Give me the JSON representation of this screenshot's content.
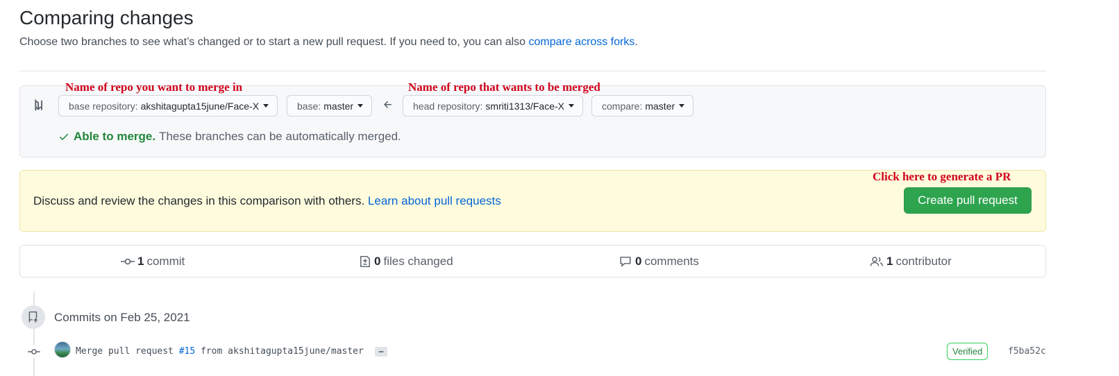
{
  "header": {
    "title": "Comparing changes",
    "subtitle_prefix": "Choose two branches to see what’s changed or to start a new pull request. If you need to, you can also ",
    "subtitle_link": "compare across forks",
    "subtitle_suffix": "."
  },
  "range": {
    "annotation_base": "Name of repo you want to merge in",
    "annotation_head": "Name of repo that wants to be merged",
    "base_repo_label": "base repository:",
    "base_repo_value": "akshitagupta15june/Face-X",
    "base_label": "base:",
    "base_value": "master",
    "head_repo_label": "head repository:",
    "head_repo_value": "smriti1313/Face-X",
    "compare_label": "compare:",
    "compare_value": "master",
    "status_strong": "Able to merge.",
    "status_text": "These branches can be automatically merged."
  },
  "prompt": {
    "annotation": "Click here to generate a PR",
    "text": "Discuss and review the changes in this comparison with others.",
    "link": "Learn about pull requests",
    "button": "Create pull request"
  },
  "stats": {
    "commits_count": "1",
    "commits_label": "commit",
    "files_count": "0",
    "files_label": "files changed",
    "comments_count": "0",
    "comments_label": "comments",
    "contributors_count": "1",
    "contributors_label": "contributor"
  },
  "timeline": {
    "date_heading": "Commits on Feb 25, 2021",
    "commit_prefix": "Merge pull request ",
    "commit_pr": "#15",
    "commit_suffix": " from akshitagupta15june/master",
    "ellipsis": "…",
    "verified": "Verified",
    "sha": "f5ba52c"
  },
  "colors": {
    "accent_link": "#0366d6",
    "success_green": "#2ea44f",
    "annotation_red": "#d0021b",
    "prompt_yellow": "#fffbdd"
  },
  "icons": [
    "compare-icon",
    "arrow-left-icon",
    "check-icon",
    "git-commit-icon",
    "file-diff-icon",
    "comment-icon",
    "people-icon",
    "repo-push-icon"
  ]
}
